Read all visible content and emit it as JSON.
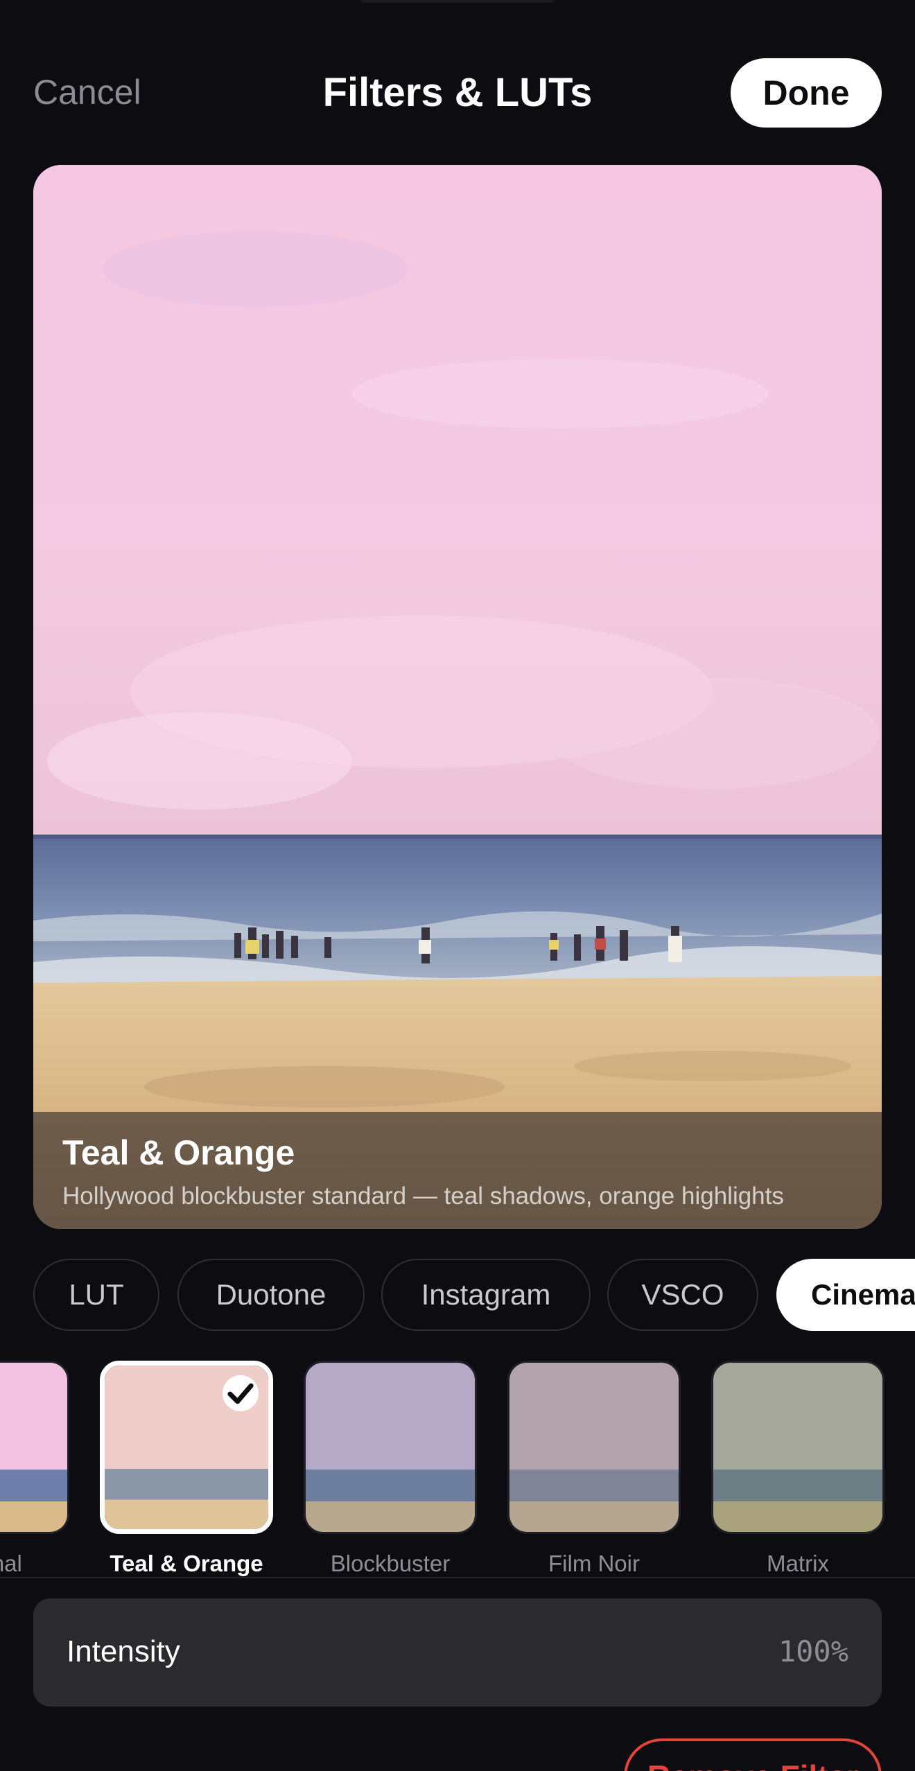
{
  "header": {
    "cancel_label": "Cancel",
    "title": "Filters & LUTs",
    "done_label": "Done"
  },
  "preview": {
    "filter_name": "Teal & Orange",
    "filter_description": "Hollywood blockbuster standard — teal shadows, orange highlights"
  },
  "categories": [
    {
      "label": "LUT",
      "active": false
    },
    {
      "label": "Duotone",
      "active": false
    },
    {
      "label": "Instagram",
      "active": false
    },
    {
      "label": "VSCO",
      "active": false
    },
    {
      "label": "Cinematic",
      "active": true
    }
  ],
  "filters": [
    {
      "label": "Original",
      "selected": false
    },
    {
      "label": "Teal & Orange",
      "selected": true
    },
    {
      "label": "Blockbuster",
      "selected": false
    },
    {
      "label": "Film Noir",
      "selected": false
    },
    {
      "label": "Matrix",
      "selected": false
    }
  ],
  "intensity": {
    "label": "Intensity",
    "value": "100%"
  },
  "remove_filter_label": "Remove Filter",
  "icons": {
    "check": "checkmark-icon"
  },
  "colors": {
    "background": "#0c0c11",
    "accent": "#ffffff",
    "destructive": "#e0443b",
    "sky": "#f2c9de",
    "sea": "#6f7fa6",
    "sand": "#d9b98a"
  }
}
